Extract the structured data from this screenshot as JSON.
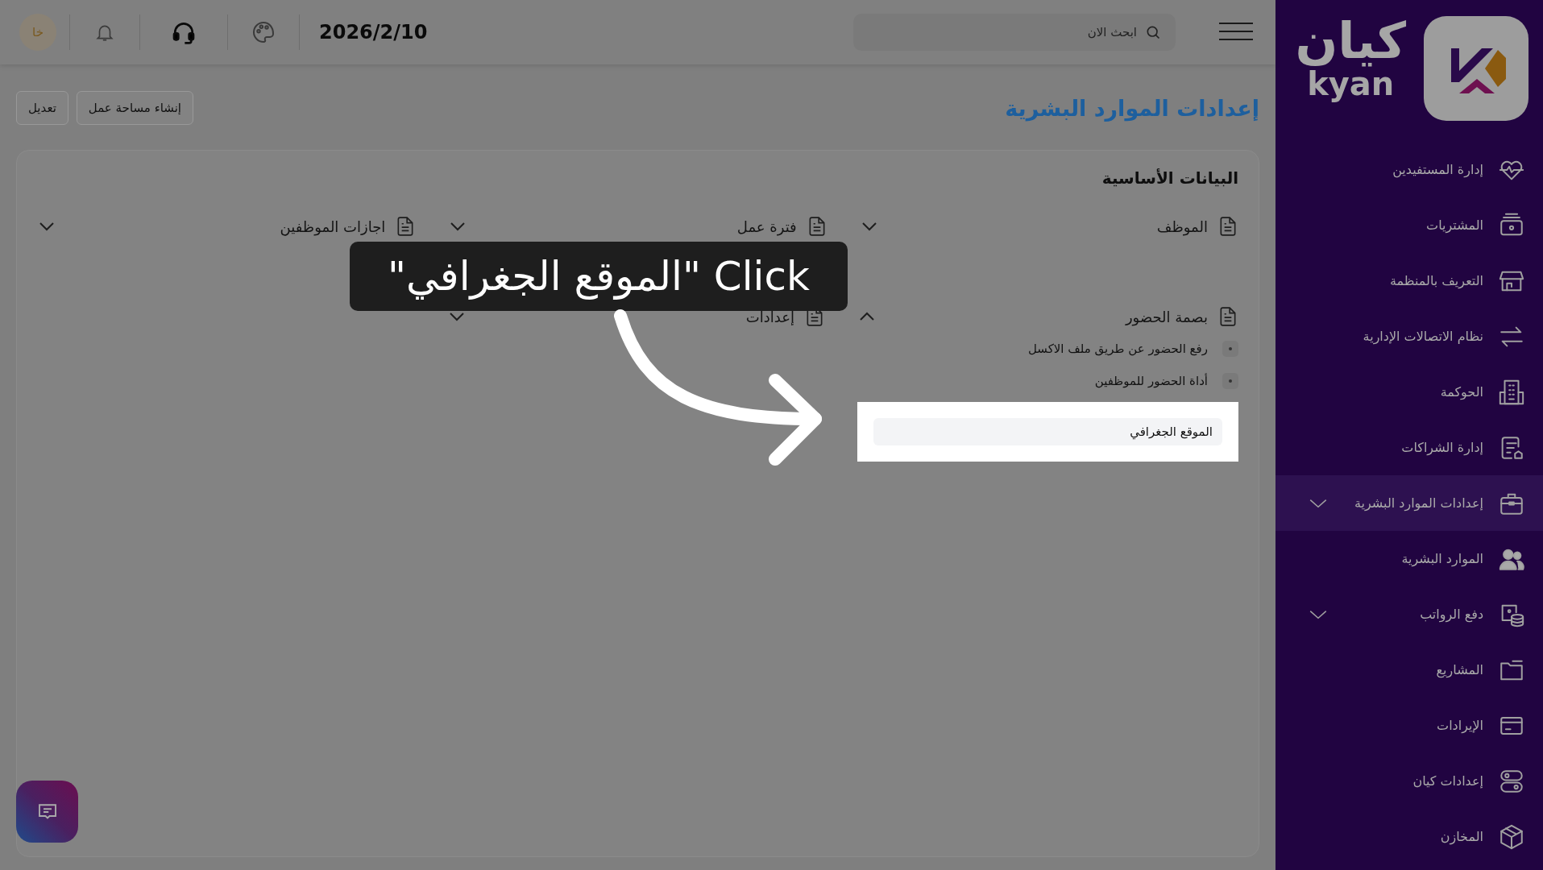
{
  "topbar": {
    "search": {
      "placeholder": "ابحث الان"
    },
    "date": "2026/2/10",
    "avatar": "خا"
  },
  "page": {
    "title": "إعدادات الموارد البشرية",
    "buttons": [
      "إنشاء مساحة عمل",
      "تعديل"
    ]
  },
  "card": {
    "title": "البيانات الأساسية",
    "sections": [
      {
        "label": "الموظف",
        "expanded": false
      },
      {
        "label": "فترة عمل",
        "expanded": false
      },
      {
        "label": "اجازات الموظفين",
        "expanded": false
      },
      {
        "label": "بصمة الحضور",
        "expanded": true,
        "children": [
          {
            "label": "رفع الحضور عن طريق ملف الاكسل",
            "highlighted": false
          },
          {
            "label": "أداة الحضور للموظفين",
            "highlighted": false
          },
          {
            "label": "الموقع الجغرافي",
            "highlighted": true
          }
        ]
      },
      {
        "label": "إعدادات",
        "expanded": false
      }
    ]
  },
  "tutorial": {
    "callout": "Click \"الموقع الجغرافي\""
  },
  "sidebar": {
    "logo": {
      "arabic": "كيان",
      "latin": "kyan"
    },
    "items": [
      {
        "label": "إدارة المستفيدين",
        "selected": false,
        "expandable": false
      },
      {
        "label": "المشتريات",
        "selected": false,
        "expandable": false
      },
      {
        "label": "التعريف بالمنظمة",
        "selected": false,
        "expandable": false
      },
      {
        "label": "نظام الاتصالات الإدارية",
        "selected": false,
        "expandable": false
      },
      {
        "label": "الحوكمة",
        "selected": false,
        "expandable": false
      },
      {
        "label": "إدارة الشراكات",
        "selected": false,
        "expandable": false
      },
      {
        "label": "إعدادات الموارد البشرية",
        "selected": true,
        "expandable": true
      },
      {
        "label": "الموارد البشرية",
        "selected": false,
        "expandable": false
      },
      {
        "label": "دفع الرواتب",
        "selected": false,
        "expandable": true
      },
      {
        "label": "المشاريع",
        "selected": false,
        "expandable": false
      },
      {
        "label": "الإيرادات",
        "selected": false,
        "expandable": false
      },
      {
        "label": "إعدادات كيان",
        "selected": false,
        "expandable": false
      },
      {
        "label": "المخازن",
        "selected": false,
        "expandable": false
      }
    ]
  }
}
